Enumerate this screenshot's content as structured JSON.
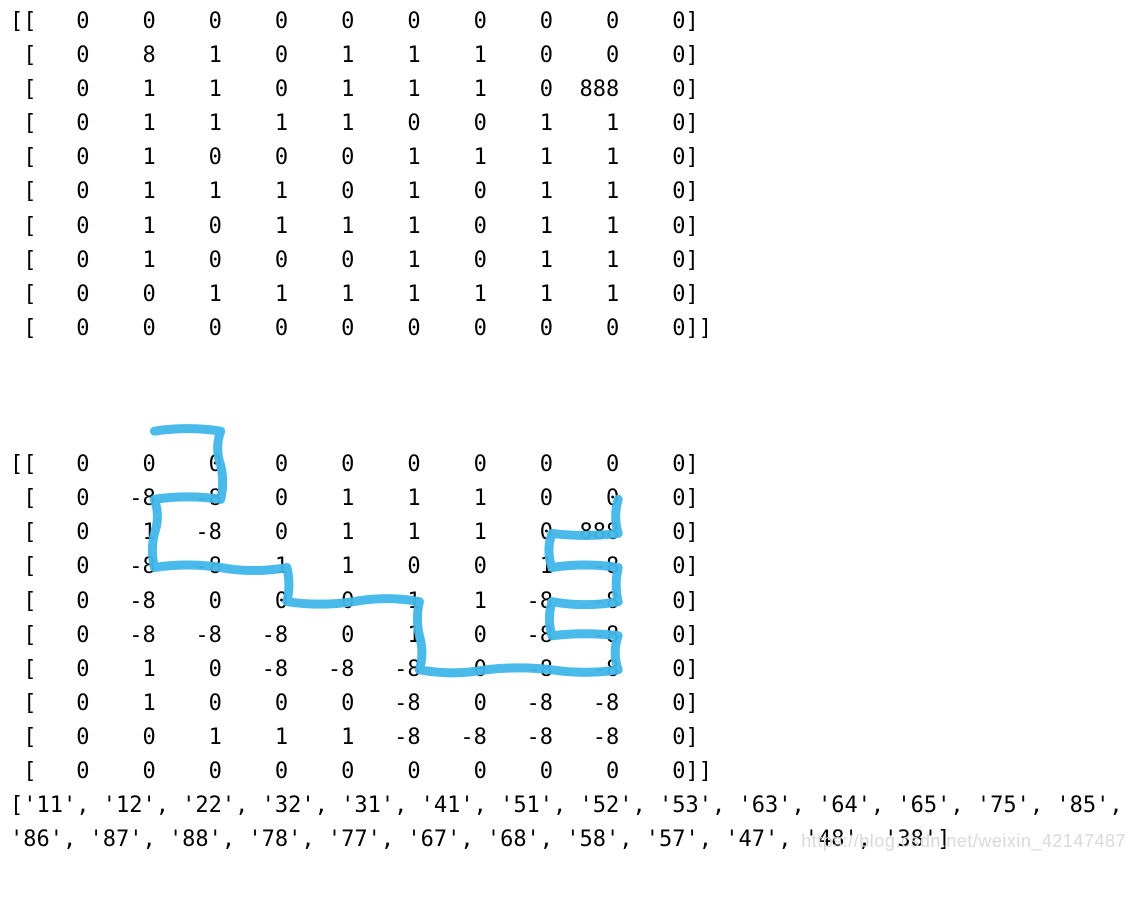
{
  "matrix1": [
    "[[   0    0    0    0    0    0    0    0    0    0]",
    " [   0    8    1    0    1    1    1    0    0    0]",
    " [   0    1    1    0    1    1    1    0  888    0]",
    " [   0    1    1    1    1    0    0    1    1    0]",
    " [   0    1    0    0    0    1    1    1    1    0]",
    " [   0    1    1    1    0    1    0    1    1    0]",
    " [   0    1    0    1    1    1    0    1    1    0]",
    " [   0    1    0    0    0    1    0    1    1    0]",
    " [   0    0    1    1    1    1    1    1    1    0]",
    " [   0    0    0    0    0    0    0    0    0    0]]"
  ],
  "matrix2": [
    "[[   0    0    0    0    0    0    0    0    0    0]",
    " [   0   -8   -8    0    1    1    1    0    0    0]",
    " [   0    1   -8    0    1    1    1    0  888    0]",
    " [   0   -8   -8    1    1    0    0    1   -8    0]",
    " [   0   -8    0    0    0    1    1   -8   -8    0]",
    " [   0   -8   -8   -8    0    1    0   -8   -8    0]",
    " [   0    1    0   -8   -8   -8    0   -8   -8    0]",
    " [   0    1    0    0    0   -8    0   -8   -8    0]",
    " [   0    0    1    1    1   -8   -8   -8   -8    0]",
    " [   0    0    0    0    0    0    0    0    0    0]]"
  ],
  "path_list": "['11', '12', '22', '32', '31', '41', '51', '52', '53', '63', '64', '65', '75', '85', '86', '87', '88', '78', '77', '67', '68', '58', '57', '47', '48', '38']",
  "watermark": "https://blog.csdn.net/weixin_42147487"
}
